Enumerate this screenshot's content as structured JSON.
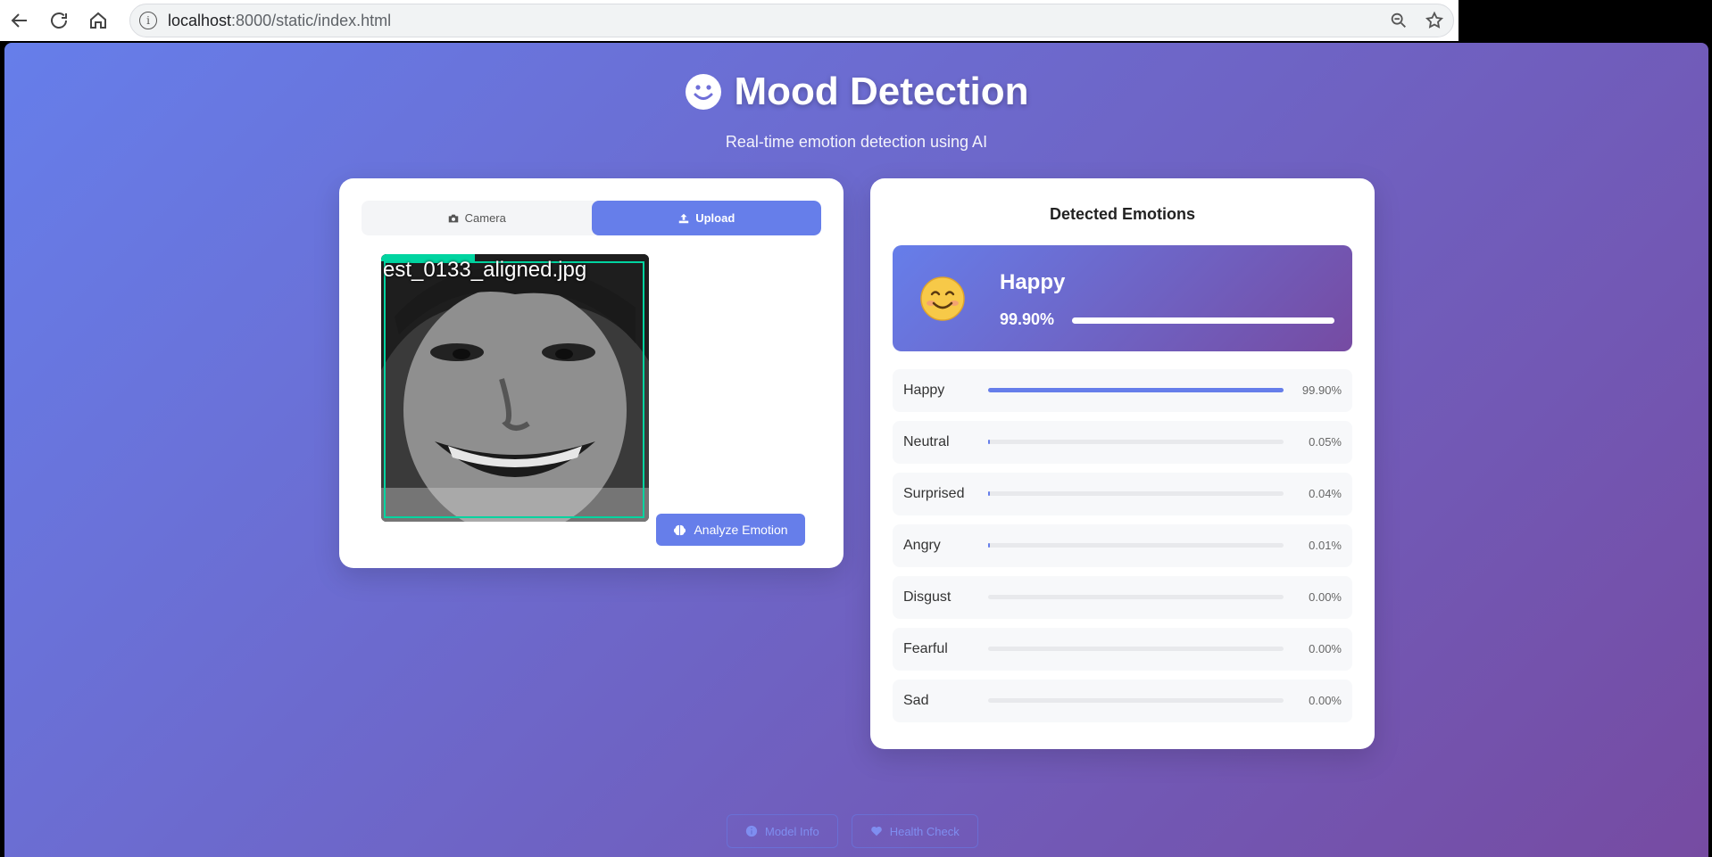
{
  "browser": {
    "url_host": "localhost",
    "url_path": ":8000/static/index.html"
  },
  "header": {
    "title": "Mood Detection",
    "subtitle": "Real-time emotion detection using AI"
  },
  "input_card": {
    "tabs": [
      {
        "label": "Camera",
        "icon": "camera-icon",
        "active": false
      },
      {
        "label": "Upload",
        "icon": "upload-icon",
        "active": true
      }
    ],
    "preview_caption": "est_0133_aligned.jpg",
    "analyze_label": "Analyze Emotion"
  },
  "results": {
    "title": "Detected Emotions",
    "top": {
      "label": "Happy",
      "value": "99.90%",
      "fraction": 0.999,
      "emoji": "smiling-face-icon"
    },
    "emotions": [
      {
        "name": "Happy",
        "value": "99.90%",
        "fraction": 0.999
      },
      {
        "name": "Neutral",
        "value": "0.05%",
        "fraction": 0.0005
      },
      {
        "name": "Surprised",
        "value": "0.04%",
        "fraction": 0.0004
      },
      {
        "name": "Angry",
        "value": "0.01%",
        "fraction": 0.0001
      },
      {
        "name": "Disgust",
        "value": "0.00%",
        "fraction": 0
      },
      {
        "name": "Fearful",
        "value": "0.00%",
        "fraction": 0
      },
      {
        "name": "Sad",
        "value": "0.00%",
        "fraction": 0
      }
    ]
  },
  "footer": {
    "model_info_label": "Model Info",
    "health_check_label": "Health Check"
  },
  "colors": {
    "accent": "#667eea",
    "gradient_end": "#764ba2",
    "box_green": "#00d4a0"
  }
}
